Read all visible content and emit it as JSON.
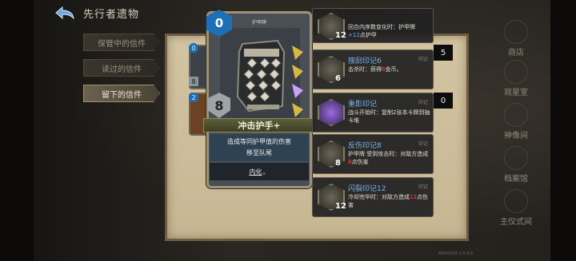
{
  "header": {
    "title": "先行者遗物"
  },
  "tabs": [
    {
      "label": "保管中的信件",
      "active": false
    },
    {
      "label": "读过的信件",
      "active": false
    },
    {
      "label": "留下的信件",
      "active": true
    }
  ],
  "card": {
    "cost": "0",
    "type_label": "护甲牌",
    "armor": "8",
    "name": "冲击护手+",
    "desc_line1": "造成等同护甲值的伤害",
    "desc_line2": "移至队尾",
    "keyword": "内化",
    "keyword_suffix": "。"
  },
  "mini_cards": [
    {
      "cost": "0",
      "armor": "8"
    },
    {
      "cost": "2"
    }
  ],
  "counters": [
    "5",
    "0"
  ],
  "tooltips": [
    {
      "name": "",
      "tag": "",
      "num": "12",
      "desc": [
        "回合内序数变化时：护甲牌",
        "+12点护甲"
      ],
      "desc_hl": "+12"
    },
    {
      "name": "搜刮印记6",
      "tag": "印记",
      "num": "6",
      "desc_pre": "击杀时：获得",
      "desc_hl": "6",
      "desc_post": "金币。"
    },
    {
      "name": "重影印记",
      "tag": "印记",
      "num": "",
      "desc_pre": "战斗开始时：复制2张本卡牌到抽卡堆",
      "desc_hl": "",
      "desc_post": ""
    },
    {
      "name": "反伤印记8",
      "tag": "印记",
      "num": "8",
      "desc_pre": "护甲牌 受到攻击时：对敌方造成",
      "desc_hl": "8",
      "desc_post": "点伤害"
    },
    {
      "name": "闪裂印记12",
      "tag": "印记",
      "num": "12",
      "desc_pre": "冷却完毕时：对敌方造成",
      "desc_hl": "12",
      "desc_post": "点伤害"
    }
  ],
  "nav": [
    {
      "label": "商店"
    },
    {
      "label": "观星室"
    },
    {
      "label": "神像间"
    },
    {
      "label": "档案馆"
    },
    {
      "label": "主仪式间"
    }
  ],
  "version": "MD42354 1.0.5.6",
  "colors": {
    "cost_blue": "#1d6fb8",
    "highlight_blue": "#6aa6ff",
    "highlight_red": "#ff4a4a"
  }
}
